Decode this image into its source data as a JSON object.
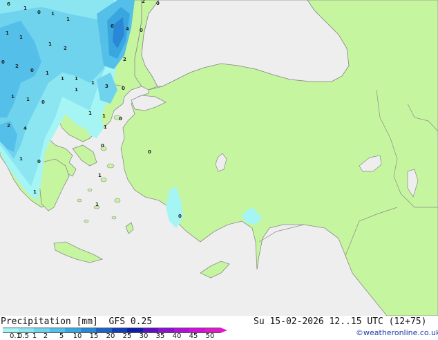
{
  "title": {
    "left": "Precipitation [mm]",
    "model": "GFS 0.25",
    "valid": "Su 15-02-2026 12..15 UTC (12+75)"
  },
  "credit": "©weatheronline.co.uk",
  "legend": {
    "ticks": [
      "0.1",
      "0.5",
      "1",
      "2",
      "5",
      "10",
      "15",
      "20",
      "25",
      "30",
      "35",
      "40",
      "45",
      "50"
    ],
    "colors": [
      "#a5f5f5",
      "#8be6f2",
      "#6fd3ee",
      "#54bfe8",
      "#3aa6e0",
      "#2a87d6",
      "#1c63c8",
      "#103eb8",
      "#0a1fa6",
      "#5a10c0",
      "#8c10d0",
      "#b010d8",
      "#d010d8",
      "#e018c8"
    ]
  },
  "colors": {
    "land": "#c6f5a0",
    "sea": "#eeeeee",
    "border": "#8a8a8a"
  },
  "rain_labels": [
    "6",
    "1",
    "0",
    "1",
    "1",
    "1",
    "1",
    "1",
    "2",
    "0",
    "2",
    "0",
    "1",
    "1",
    "1",
    "1",
    "3",
    "0",
    "2",
    "1",
    "1",
    "0",
    "1",
    "2",
    "4",
    "1",
    "0",
    "1",
    "1",
    "1",
    "0",
    "0",
    "0",
    "1",
    "1",
    "1",
    "0",
    "0",
    "4",
    "6",
    "0",
    "2"
  ]
}
